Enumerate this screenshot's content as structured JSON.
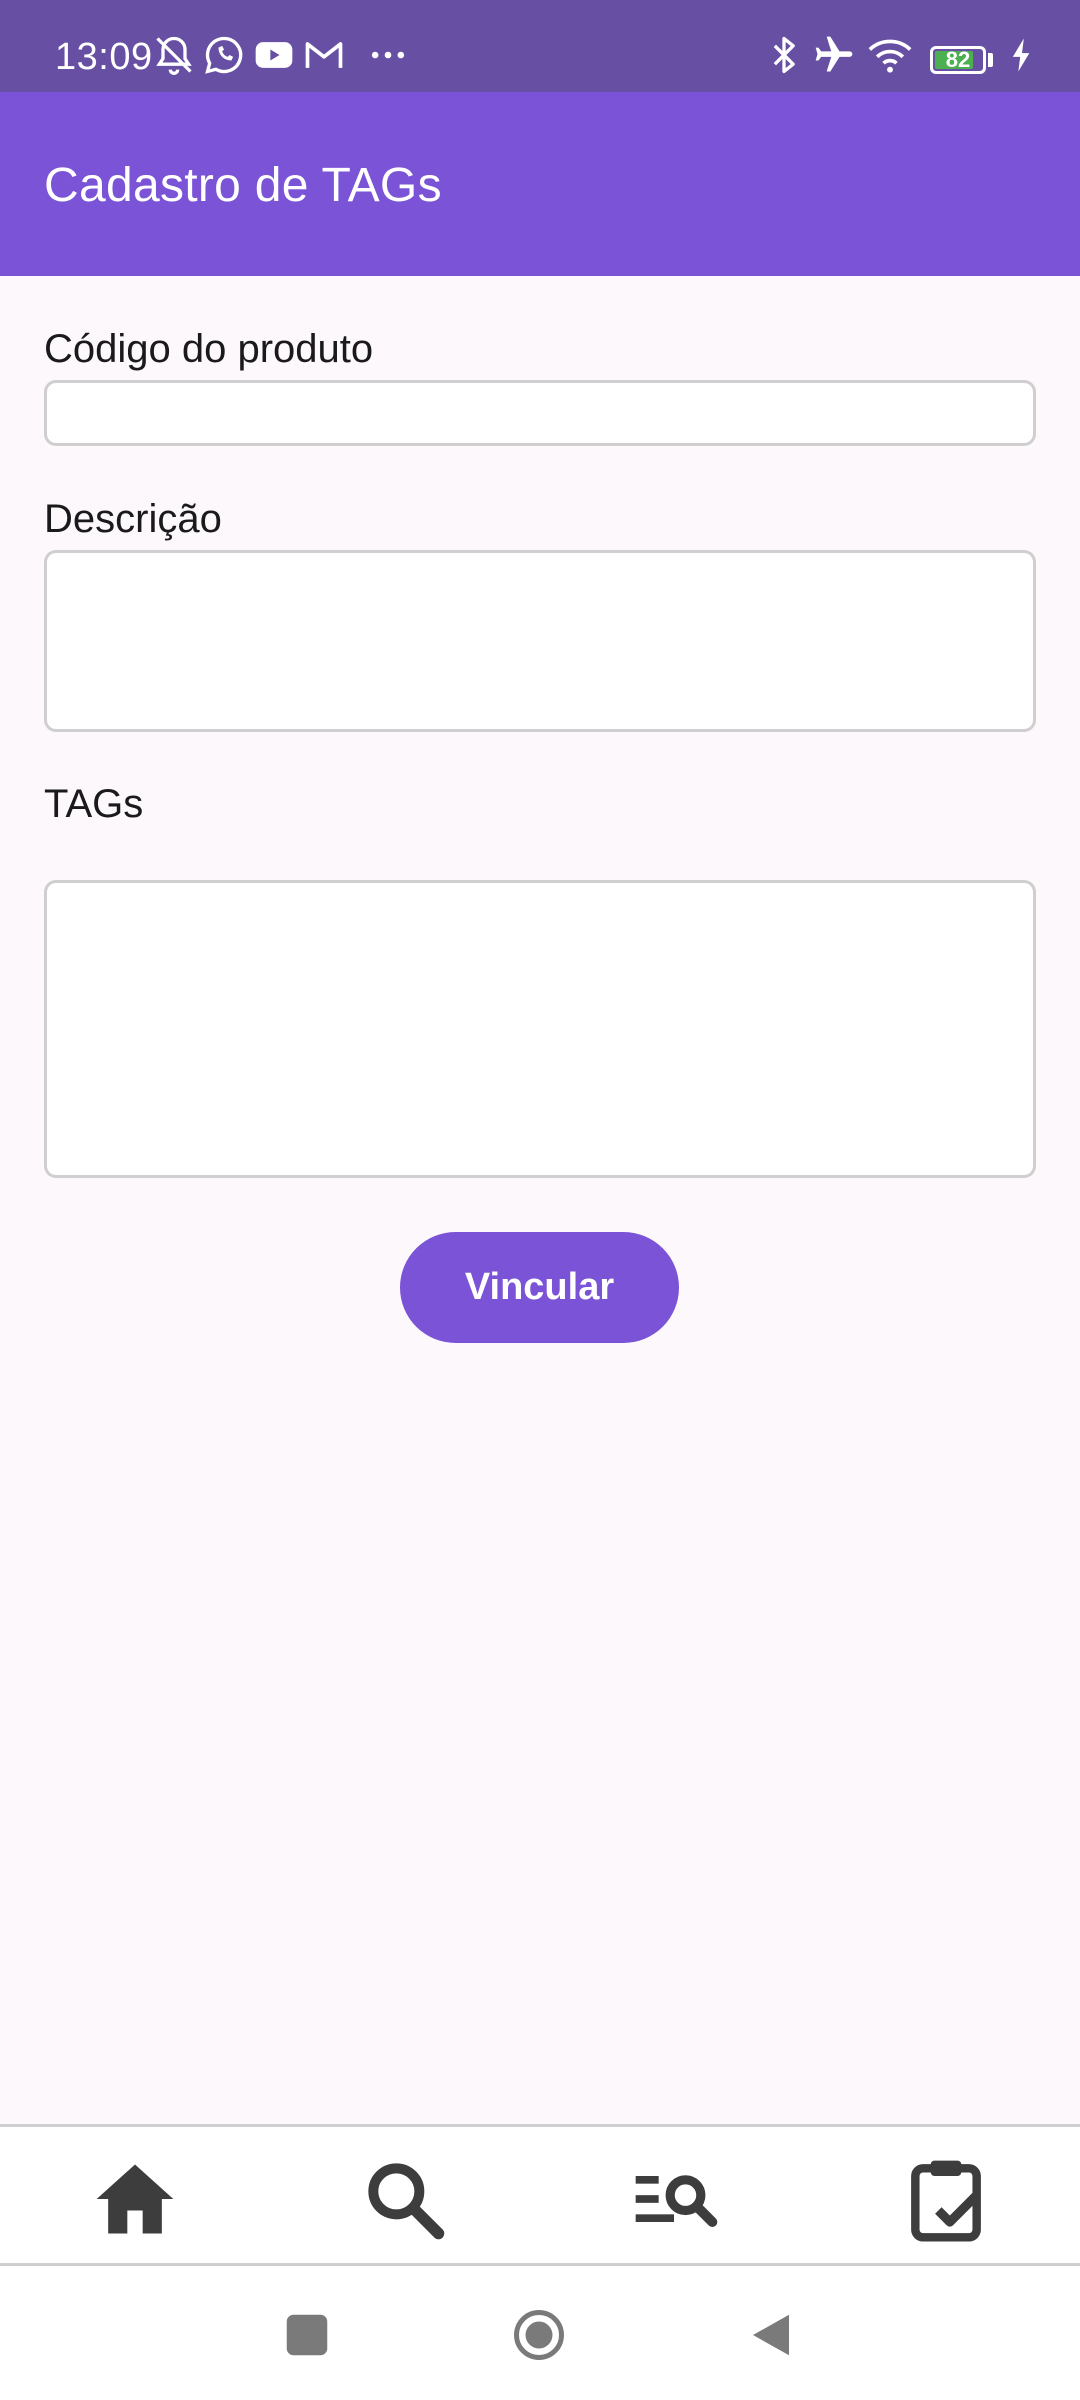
{
  "status_bar": {
    "time": "13:09",
    "icons": [
      "muted-bell-icon",
      "whatsapp-icon",
      "youtube-icon",
      "gmail-icon",
      "more-dots-icon",
      "bluetooth-icon",
      "airplane-icon",
      "wifi-icon",
      "battery-icon",
      "charging-icon"
    ],
    "battery_level": "82",
    "battery_fraction": 0.82
  },
  "app_bar": {
    "title": "Cadastro de TAGs"
  },
  "form": {
    "codigo_label": "Código do produto",
    "codigo_value": "",
    "descricao_label": "Descrição",
    "descricao_value": "",
    "tags_label": "TAGs",
    "tags_value": "",
    "submit_label": "Vincular"
  },
  "bottom_nav": {
    "items": [
      "home-icon",
      "search-icon",
      "list-search-icon",
      "clipboard-check-icon"
    ]
  },
  "system_nav": {
    "items": [
      "recents-icon",
      "home-circle-icon",
      "back-icon"
    ]
  },
  "colors": {
    "status_bar": "#6750a4",
    "primary": "#7a53d6",
    "background": "#fdf8fc",
    "icon": "#3d3d3d"
  }
}
